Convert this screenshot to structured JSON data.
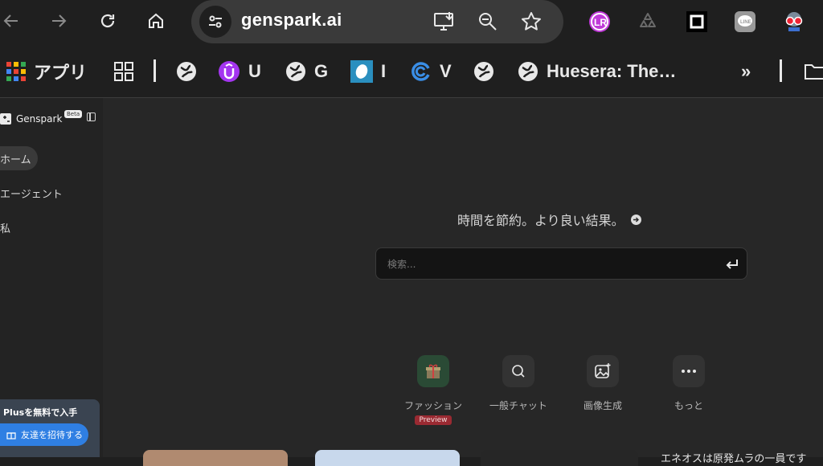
{
  "browser": {
    "url": "genspark.ai",
    "icons": [
      "back-icon",
      "forward-icon",
      "reload-icon",
      "home-icon",
      "site-info-icon",
      "install-app-icon",
      "zoom-icon",
      "star-icon"
    ]
  },
  "extensions": [
    "lr-extension-icon",
    "recycle-extension-icon",
    "square-extension-icon",
    "line-extension-icon",
    "goggles-extension-icon"
  ],
  "bookmarks": {
    "apps_label": "アプリ",
    "items": [
      {
        "label": "U"
      },
      {
        "label": "G"
      },
      {
        "label": "I"
      },
      {
        "label": "V"
      },
      {
        "label": ""
      },
      {
        "label": "Huesera: The…"
      }
    ],
    "more": "»"
  },
  "sidebar": {
    "brand": "Genspark",
    "beta": "Beta",
    "items": [
      {
        "label": "ホーム",
        "active": true
      },
      {
        "label": "エージェント"
      },
      {
        "label": "私"
      }
    ],
    "promo_title": "Plusを無料で入手",
    "invite_label": "友達を招待する"
  },
  "main": {
    "headline": "時間を節約。より良い結果。",
    "search_placeholder": "検索...",
    "features": [
      {
        "label": "ファッション",
        "badge": "Preview",
        "icon": "gift-icon"
      },
      {
        "label": "一般チャット",
        "icon": "chat-icon"
      },
      {
        "label": "画像生成",
        "icon": "image-sparkle-icon"
      },
      {
        "label": "もっと",
        "icon": "more-dots-icon"
      }
    ],
    "card_text": "エネオスは原発ムラの一員です"
  },
  "colors": {
    "accent_blue": "#2f7fe3",
    "preview_red": "#9a2a32",
    "fashion_green": "#2a4a35"
  }
}
